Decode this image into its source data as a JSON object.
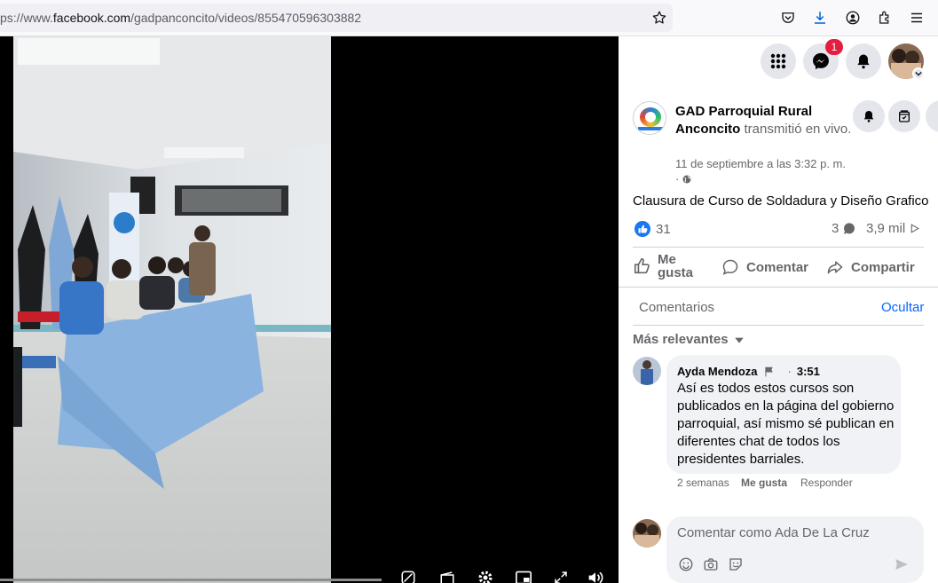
{
  "browser": {
    "url_prefix": "ps://www.",
    "url_domain": "facebook.com",
    "url_path": "/gadpanconcito/videos/855470596303882"
  },
  "topnav": {
    "messenger_badge": "1"
  },
  "post": {
    "page_name": "GAD Parroquial Rural Anconcito",
    "action_text": "transmitió en vivo.",
    "timestamp": "11 de septiembre a las 3:32 p. m.",
    "visibility_sep": "·",
    "title": "Clausura de Curso de Soldadura y Diseño Grafico",
    "likes": "31",
    "comments_count": "3",
    "views": "3,9 mil"
  },
  "actions": {
    "like": "Me gusta",
    "comment": "Comentar",
    "share": "Compartir"
  },
  "comments_section": {
    "heading": "Comentarios",
    "hide": "Ocultar",
    "sort": "Más relevantes"
  },
  "comment": {
    "author": "Ayda Mendoza",
    "time": "3:51",
    "text": "Así es todos estos cursos son publicados en la página del gobierno parroquial, así mismo sé publican en diferentes chat de todos los presidentes barriales.",
    "age": "2 semanas",
    "like": "Me gusta",
    "reply": "Responder"
  },
  "composer": {
    "placeholder": "Comentar como Ada De La Cruz"
  },
  "colors": {
    "accent": "#0866ff",
    "badge": "#e41e3f"
  }
}
